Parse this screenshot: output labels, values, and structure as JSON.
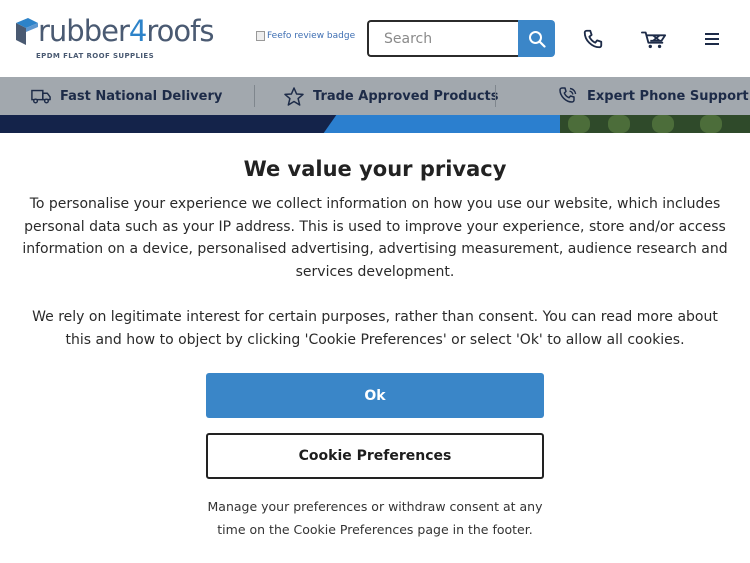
{
  "header": {
    "logo": {
      "name_part1": "rubber",
      "name_part2": "4",
      "name_part3": "roofs",
      "tagline": "EPDM FLAT ROOF SUPPLIES"
    },
    "feefo_badge_alt": "Feefo review badge",
    "search": {
      "placeholder": "Search",
      "value": ""
    },
    "icons": {
      "search": "search-icon",
      "phone": "phone-icon",
      "cart": "cart-icon",
      "menu": "menu-icon"
    }
  },
  "usp_bar": {
    "items": [
      {
        "label": "Fast National Delivery",
        "icon": "delivery-truck-icon"
      },
      {
        "label": "Trade Approved Products",
        "icon": "star-icon"
      },
      {
        "label": "Expert Phone Support",
        "icon": "phone-support-icon"
      }
    ]
  },
  "cookie_dialog": {
    "title": "We value your privacy",
    "paragraph1": "To personalise your experience we collect information on how you use our website, which includes personal data such as your IP address. This is used to improve your experience, store and/or access information on a device, personalised advertising, advertising measurement, audience research and services development.",
    "paragraph2": "We rely on legitimate interest for certain purposes, rather than consent. You can read more about this and how to object by clicking 'Cookie Preferences' or select 'Ok' to allow all cookies.",
    "ok_label": "Ok",
    "preferences_label": "Cookie Preferences",
    "footer_note": "Manage your preferences or withdraw consent at any time on the Cookie Preferences page in the footer."
  },
  "colors": {
    "brand_blue": "#3a86c8",
    "brand_navy": "#1d2b48",
    "usp_bar_bg": "#a2a8ae"
  }
}
